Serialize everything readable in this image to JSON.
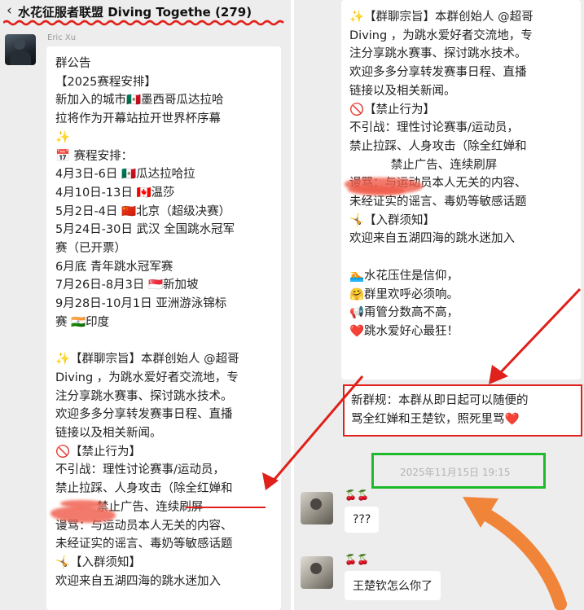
{
  "left": {
    "header": {
      "title": "水花征服者联盟 Diving Togethe (279)"
    },
    "sender": "Eric Xu",
    "lines": [
      "群公告",
      "【2025赛程安排】",
      "新加入的城市🇲🇽墨西哥瓜达拉哈",
      "拉将作为开幕站拉开世界杯序幕",
      "✨",
      "📅 赛程安排：",
      "4月3日-6日 🇲🇽瓜达拉哈拉",
      "4月10日-13日 🇨🇦温莎",
      "5月2日-4日 🇨🇳北京（超级决赛）",
      "5月24日-30日 武汉 全国跳水冠军",
      "赛（已开票）",
      "6月底 青年跳水冠军赛",
      "7月26日-8月3日 🇸🇬新加坡",
      "9月28日-10月1日 亚洲游泳锦标",
      "赛 🇮🇳印度",
      "",
      "✨【群聊宗旨】本群创始人 @超哥",
      "Diving ，为跳水爱好者交流地，专",
      "注分享跳水赛事、探讨跳水技术。",
      "欢迎多多分享转发赛事日程、直播",
      "链接以及相关新闻。",
      "🚫【禁止行为】",
      "不引战：理性讨论赛事/运动员，",
      "禁止拉踩、人身攻击（除全红婵和",
      "           禁止广告、连续刷屏",
      "谩骂：与运动员本人无关的内容、",
      "未经证实的谣言、毒奶等敏感话题",
      "🤸【入群须知】",
      "欢迎来自五湖四海的跳水迷加入"
    ]
  },
  "right": {
    "lines": [
      "✨【群聊宗旨】本群创始人 @超哥",
      "Diving ，为跳水爱好者交流地，专",
      "注分享跳水赛事、探讨跳水技术。",
      "欢迎多多分享转发赛事日程、直播",
      "链接以及相关新闻。",
      "🚫【禁止行为】",
      "不引战：理性讨论赛事/运动员，",
      "禁止拉踩、人身攻击（除全红婵和",
      "           禁止广告、连续刷屏",
      "谩骂：与运动员本人无关的内容、",
      "未经证实的谣言、毒奶等敏感话题",
      "🤸【入群须知】",
      "欢迎来自五湖四海的跳水迷加入",
      "",
      "🏊水花压住是信仰，",
      "🤗群里欢呼必须响。",
      "📢甭管分数高不高，",
      "❤️跳水爱好心最狂！"
    ],
    "new_rule_lines": [
      "新群规：本群从即日起可以随便的",
      "骂全红婵和王楚钦，照死里骂❤️"
    ],
    "timestamp": "2025年11月15日 19:15",
    "msg1": {
      "reaction": "🍒🍒",
      "text": "???"
    },
    "msg2": {
      "reaction": "🍒🍒",
      "text": "王楚钦怎么你了"
    }
  },
  "colors": {
    "annotation_red": "#e0201a",
    "annotation_green": "#1fba2c",
    "annotation_orange": "#f0853a"
  }
}
